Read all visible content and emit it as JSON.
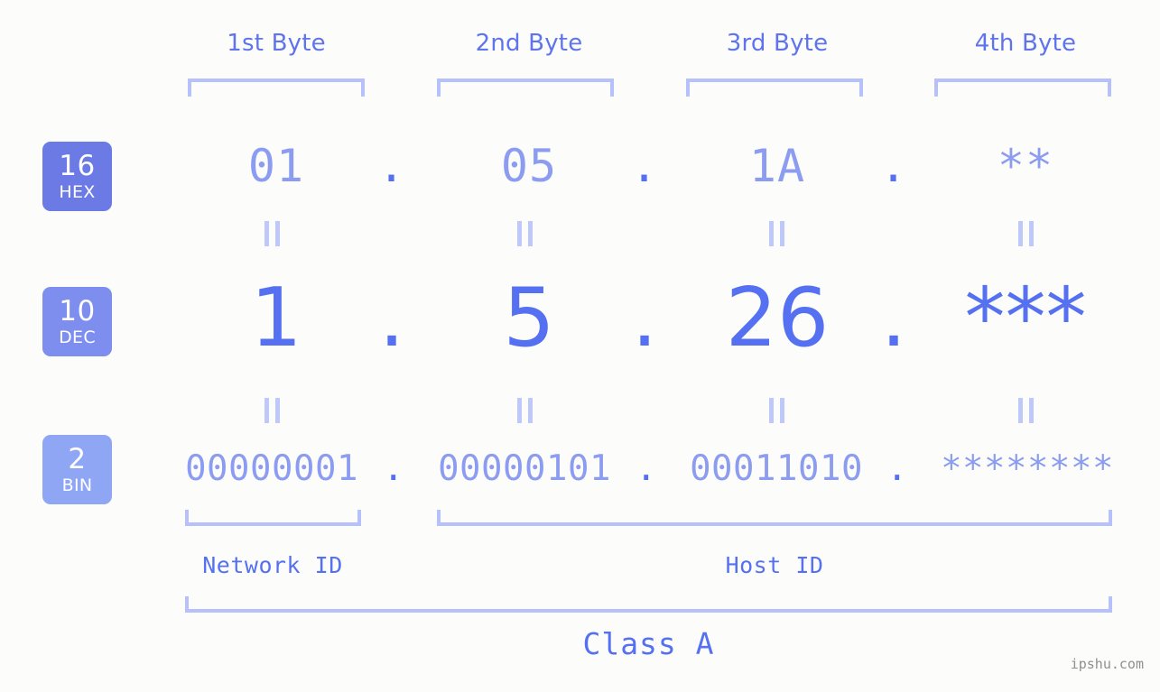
{
  "colors": {
    "background": "#fcfdfa",
    "header_text": "#5f74ec",
    "bracket": "#b6c0fb",
    "hex_text": "#8c9cf0",
    "dec_text": "#5570f1",
    "bin_text": "#8c9cf0",
    "badge_hex": "#6c7ae6",
    "badge_dec": "#7d8eef",
    "badge_bin": "#8fa6f5",
    "equals_bar": "#bfc8fb",
    "watermark": "#8f8f8f"
  },
  "byte_headers": [
    {
      "label": "1st Byte"
    },
    {
      "label": "2nd Byte"
    },
    {
      "label": "3rd Byte"
    },
    {
      "label": "4th Byte"
    }
  ],
  "rows": [
    {
      "key": "hex",
      "badge_number": "16",
      "badge_name": "HEX",
      "values": [
        "01",
        "05",
        "1A",
        "**"
      ],
      "separators": [
        ".",
        ".",
        "."
      ]
    },
    {
      "key": "dec",
      "badge_number": "10",
      "badge_name": "DEC",
      "values": [
        "1",
        "5",
        "26",
        "***"
      ],
      "separators": [
        ".",
        ".",
        "."
      ]
    },
    {
      "key": "bin",
      "badge_number": "2",
      "badge_name": "BIN",
      "values": [
        "00000001",
        "00000101",
        "00011010",
        "********"
      ],
      "separators": [
        ".",
        ".",
        "."
      ]
    }
  ],
  "id_sections": [
    {
      "label": "Network ID"
    },
    {
      "label": "Host ID"
    }
  ],
  "class_label": "Class A",
  "watermark": "ipshu.com"
}
